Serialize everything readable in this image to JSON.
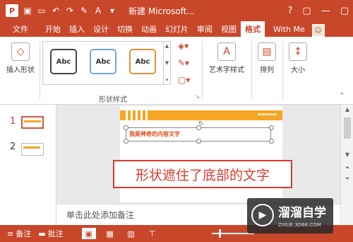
{
  "titlebar": {
    "app_logo": "P",
    "title": "新建 Microsoft...",
    "help": "?",
    "controls": [
      "▢",
      "—",
      "▢"
    ]
  },
  "tabs": {
    "file": "文件",
    "items": [
      "开始",
      "插入",
      "设计",
      "切换",
      "动画",
      "幻灯片",
      "审阅",
      "视图",
      "格式"
    ],
    "active": "格式",
    "user": "With Me"
  },
  "ribbon": {
    "insert_shape": "插入形状",
    "style_samples": [
      "Abc",
      "Abc",
      "Abc"
    ],
    "style_colors": [
      "#444444",
      "#6fa8dc",
      "#e69138"
    ],
    "group_shape_styles": "形状样式",
    "wordart": "艺术字样式",
    "arrange": "排列",
    "size": "大小"
  },
  "thumbnails": {
    "numbers": [
      "1",
      "2"
    ],
    "selected": 1
  },
  "slide": {
    "header_text": "我是神奇的内容文字",
    "callout": "形状遮住了底部的文字"
  },
  "notes": {
    "placeholder": "单击此处添加备注"
  },
  "status": {
    "notes": "备注",
    "comments": "批注"
  },
  "watermark": {
    "title": "溜溜自学",
    "url": "ZIXUE.3D66.COM"
  },
  "colors": {
    "accent": "#c8472a",
    "callout": "#d83b2d",
    "slide_bar": "#f5a623"
  }
}
